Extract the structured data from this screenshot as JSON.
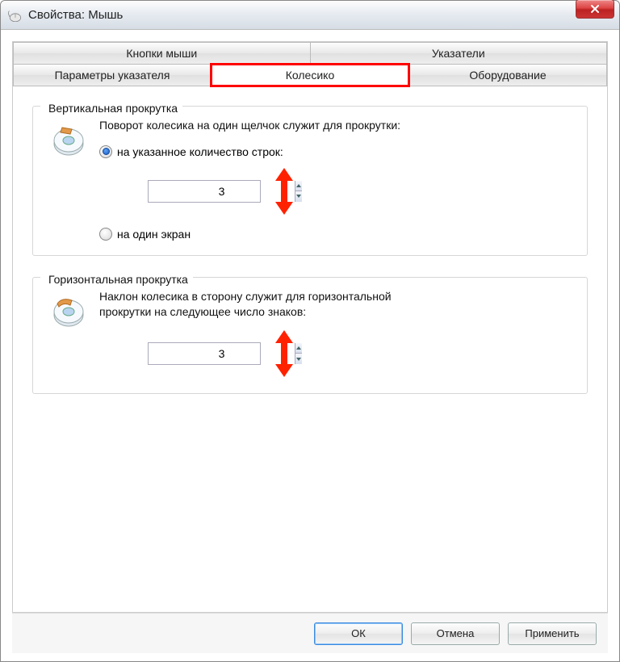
{
  "window": {
    "title": "Свойства: Мышь"
  },
  "tabs": {
    "row1": [
      "Кнопки мыши",
      "Указатели"
    ],
    "row2": [
      "Параметры указателя",
      "Колесико",
      "Оборудование"
    ],
    "active": "Колесико"
  },
  "vertical": {
    "legend": "Вертикальная прокрутка",
    "desc": "Поворот колесика на один щелчок служит для прокрутки:",
    "opt_lines": "на указанное количество строк:",
    "lines_value": "3",
    "opt_screen": "на один экран",
    "selected": "lines"
  },
  "horizontal": {
    "legend": "Горизонтальная прокрутка",
    "desc": "Наклон колесика в сторону служит для горизонтальной прокрутки на следующее число знаков:",
    "chars_value": "3"
  },
  "buttons": {
    "ok": "ОК",
    "cancel": "Отмена",
    "apply": "Применить"
  }
}
